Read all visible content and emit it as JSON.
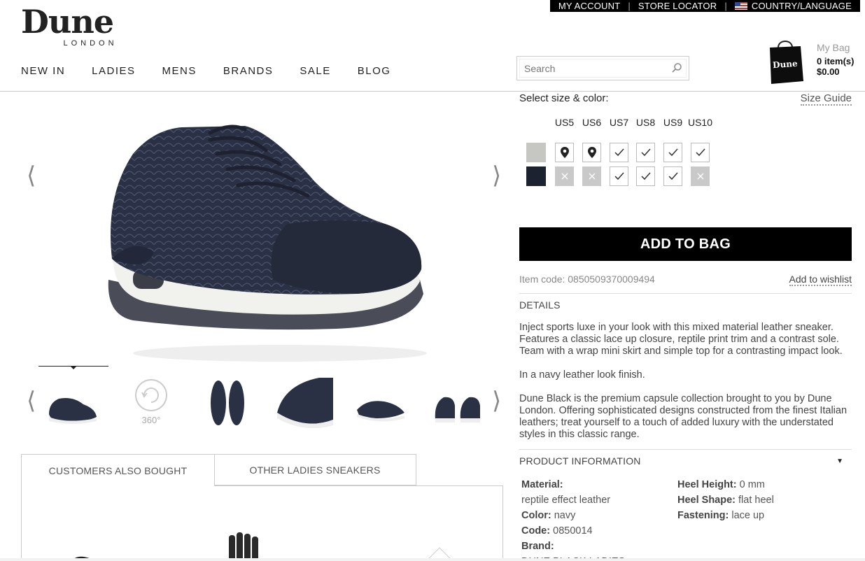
{
  "util_bar": {
    "my_account": "MY ACCOUNT",
    "store_locator": "STORE LOCATOR",
    "country_language": "COUNTRY/LANGUAGE"
  },
  "logo": {
    "name": "Dune",
    "sub": "LONDON"
  },
  "nav": [
    "NEW IN",
    "LADIES",
    "MENS",
    "BRANDS",
    "SALE",
    "BLOG"
  ],
  "search": {
    "placeholder": "Search"
  },
  "bag": {
    "title": "My Bag",
    "items": "0 item(s)",
    "total": "$0.00",
    "logo_text": "Dune"
  },
  "gallery": {
    "thumb_360_label": "360°"
  },
  "tabs": {
    "customers_also_bought": "CUSTOMERS ALSO BOUGHT",
    "other": "OTHER LADIES SNEAKERS"
  },
  "product": {
    "select_label": "Select size & color:",
    "size_guide": "Size Guide",
    "sizes": [
      "US5",
      "US6",
      "US7",
      "US8",
      "US9",
      "US10"
    ],
    "availability": [
      [
        "store",
        "store",
        "check",
        "check",
        "check",
        "check"
      ],
      [
        "na",
        "na",
        "check",
        "check",
        "check",
        "na"
      ]
    ],
    "colors": {
      "swatch1": "#c6c6c3",
      "swatch2": "#1c2230"
    },
    "add_to_bag": "ADD TO BAG",
    "item_code": "Item code: 0850509370009494",
    "add_to_wishlist": "Add to wishlist",
    "details_heading": "DETAILS",
    "desc_p1": "Inject sports luxe in your look with this mixed material leather sneaker. Features a classic lace up closure, reptile print trim and a contrast sole. Team with a wrap mini skirt and simple top for a contrasting impact look.",
    "desc_p2": "In a navy leather look finish.",
    "desc_p3": "Dune Black is the premium capsule collection brought to you by Dune London. Offering sophisticated designs constructed from the finest Italian leathers; treat yourself to a touch of added luxury with the understated styles in this classic range.",
    "info_heading": "PRODUCT INFORMATION",
    "info_caret": "▼",
    "info": {
      "material_label": "Material:",
      "material_value": "reptile effect leather",
      "color_label": "Color:",
      "color_value": "navy",
      "code_label": "Code:",
      "code_value": "0850014",
      "brand_label": "Brand:",
      "brand_value": "DUNE BLACK LADIES",
      "heel_height_label": "Heel Height:",
      "heel_height_value": "0 mm",
      "heel_shape_label": "Heel Shape:",
      "heel_shape_value": "flat heel",
      "fastening_label": "Fastening:",
      "fastening_value": "lace up"
    }
  }
}
